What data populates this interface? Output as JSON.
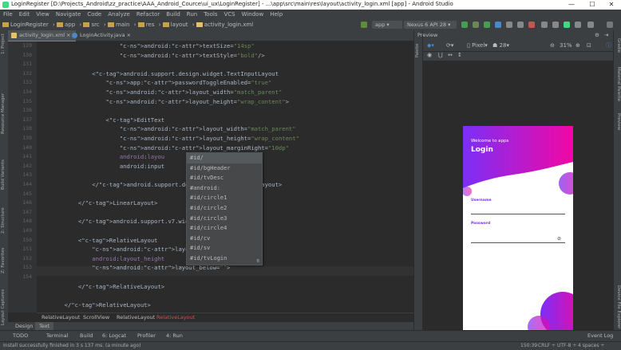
{
  "window": {
    "title": "LoginRegister [D:\\Projects_Android\\zz_practice\\AAA_Android_Cource\\ui_ux\\LoginRegister] - ...\\app\\src\\main\\res\\layout\\activity_login.xml [app] - Android Studio",
    "minimize": "—",
    "maximize": "☐",
    "close": "✕"
  },
  "menu": [
    "File",
    "Edit",
    "View",
    "Navigate",
    "Code",
    "Analyze",
    "Refactor",
    "Build",
    "Run",
    "Tools",
    "VCS",
    "Window",
    "Help"
  ],
  "breadcrumb": [
    "LoginRegister",
    "app",
    "src",
    "main",
    "res",
    "layout",
    "activity_login.xml"
  ],
  "toolbar": {
    "run_config": "app",
    "device": "Nexus 6 API 28"
  },
  "editor_tabs": [
    {
      "label": "activity_login.xml",
      "active": true
    },
    {
      "label": "LoginActivity.java",
      "active": false
    }
  ],
  "line_numbers": [
    "129",
    "130",
    "131",
    "132",
    "133",
    "134",
    "135",
    "136",
    "137",
    "138",
    "139",
    "140",
    "141",
    "142",
    "143",
    "144",
    "145",
    "146",
    "147",
    "148",
    "149",
    "150",
    "151",
    "152",
    "153",
    "154"
  ],
  "code_lines": [
    {
      "t": "                        android:textSize=\"14sp\""
    },
    {
      "t": "                        android:textStyle=\"bold\"/>"
    },
    {
      "t": ""
    },
    {
      "t": "                <android.support.design.widget.TextInputLayout"
    },
    {
      "t": "                    app:passwordToggleEnabled=\"true\""
    },
    {
      "t": "                    android:layout_width=\"match_parent\""
    },
    {
      "t": "                    android:layout_height=\"wrap_content\">"
    },
    {
      "t": ""
    },
    {
      "t": "                    <EditText"
    },
    {
      "t": "                        android:layout_width=\"match_parent\""
    },
    {
      "t": "                        android:layout_height=\"wrap_content\""
    },
    {
      "t": "                        android:layout_marginRight=\"10dp\""
    },
    {
      "t": "                        android:layou"
    },
    {
      "t": "                        android:input                   />"
    },
    {
      "t": ""
    },
    {
      "t": "                </android.support.des                   Layout>"
    },
    {
      "t": ""
    },
    {
      "t": "            </LinearLayout>"
    },
    {
      "t": ""
    },
    {
      "t": "            </android.support.v7.widg"
    },
    {
      "t": ""
    },
    {
      "t": "            <RelativeLayout"
    },
    {
      "t": "                android:layout_width="
    },
    {
      "t": "                android:layout_height"
    },
    {
      "t": "                android:layout_below=\"\">"
    },
    {
      "t": ""
    },
    {
      "t": "            </RelativeLayout>"
    },
    {
      "t": ""
    },
    {
      "t": "        </RelativeLayout>"
    }
  ],
  "autocomplete": [
    "#id/",
    "#id/bgHeader",
    "#id/tvDesc",
    "#android:",
    "#id/circle1",
    "#id/circle2",
    "#id/circle3",
    "#id/circle4",
    "#id/cv",
    "#id/sv",
    "#id/tvLogin"
  ],
  "autocomplete_footer": "π",
  "code_breadcrumb": [
    "RelativeLayout",
    "ScrollView",
    "RelativeLayout",
    "RelativeLayout"
  ],
  "bottom_tabs": [
    {
      "label": "Design",
      "active": false
    },
    {
      "label": "Text",
      "active": true
    }
  ],
  "tool_windows": [
    "TODO",
    "Terminal",
    "Build",
    "6: Logcat",
    "Profiler",
    "4: Run",
    "Event Log"
  ],
  "status": {
    "message": "Install successfully finished in 3 s 137 ms. (a minute ago)",
    "position": "150:39",
    "line_sep": "CRLF ÷",
    "encoding": "UTF-8 ÷",
    "indent": "4 spaces ÷"
  },
  "left_tools": [
    "1: Project",
    "Resource Manager",
    "Build Variants",
    "2: Structure",
    "Z: Favorites",
    "Layout Captures"
  ],
  "right_tools": [
    "Gradle",
    "Material Palette",
    "Preview",
    "Device File Explorer"
  ],
  "preview": {
    "title": "Preview",
    "device": "Pixel",
    "api": "28",
    "zoom": "31%",
    "phone": {
      "welcome": "Welcome to apps",
      "heading": "Login",
      "username_label": "Username",
      "password_label": "Password"
    }
  },
  "colors": {
    "accent": "#4a88c7",
    "gradient_start": "#7b2ff7",
    "gradient_end": "#f107a3"
  }
}
